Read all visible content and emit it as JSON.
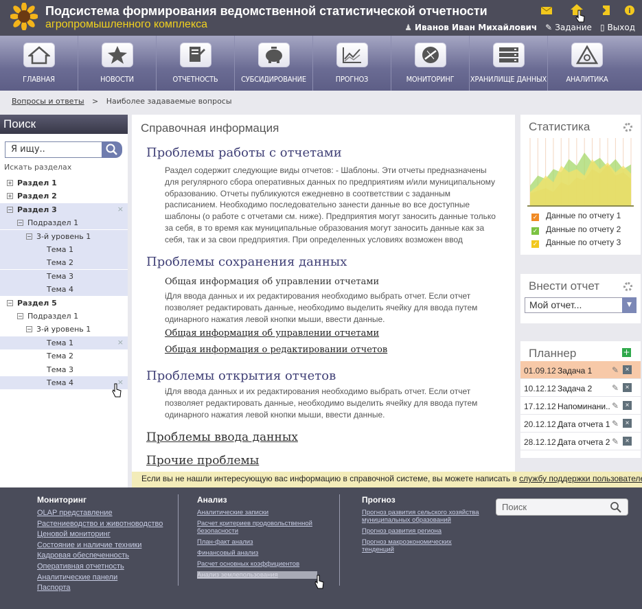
{
  "header": {
    "title": "Подсистема формирования ведомственной статистической отчетности",
    "subtitle": "агропромышленного комплекса",
    "user": "Иванов Иван Михайлович",
    "task_label": "Задание",
    "exit_label": "Выход"
  },
  "nav": [
    {
      "label": "ГЛАВНАЯ",
      "icon": "home-icon"
    },
    {
      "label": "НОВОСТИ",
      "icon": "star-icon"
    },
    {
      "label": "ОТЧЕТНОСТЬ",
      "icon": "report-icon"
    },
    {
      "label": "СУБСИДИРОВАНИЕ",
      "icon": "piggybank-icon"
    },
    {
      "label": "ПРОГНОЗ",
      "icon": "forecast-chart-icon"
    },
    {
      "label": "МОНИТОРИНГ",
      "icon": "monitoring-icon"
    },
    {
      "label": "ХРАНИЛИЩЕ ДАННЫХ",
      "icon": "server-icon"
    },
    {
      "label": "АНАЛИТИКА",
      "icon": "analytics-icon"
    }
  ],
  "breadcrumb": {
    "link": "Вопросы и ответы",
    "sep": ">",
    "current": "Наиболее задаваемые вопросы"
  },
  "search": {
    "title": "Поиск",
    "placeholder": "Я ищу..",
    "sections_label": "Искать разделах"
  },
  "tree": [
    {
      "label": "Раздел 1",
      "level": 0,
      "bold": true,
      "expander": "+"
    },
    {
      "label": "Раздел 2",
      "level": 0,
      "bold": true,
      "expander": "+"
    },
    {
      "label": "Раздел 3",
      "level": 0,
      "bold": true,
      "expander": "−",
      "selected": true,
      "close": true
    },
    {
      "label": "Подраздел 1",
      "level": 1,
      "expander": "−",
      "selected": true
    },
    {
      "label": "3-й уровень 1",
      "level": 2,
      "expander": "−",
      "selected": true
    },
    {
      "label": "Тема 1",
      "level": 3,
      "selected": true
    },
    {
      "label": "Тема 2",
      "level": 3,
      "selected": true
    },
    {
      "label": "Тема 3",
      "level": 3,
      "selected": true
    },
    {
      "label": "Тема 4",
      "level": 3,
      "selected": true
    },
    {
      "label": "Раздел 5",
      "level": 0,
      "bold": true,
      "expander": "−"
    },
    {
      "label": "Подраздел 1",
      "level": 1,
      "expander": "−"
    },
    {
      "label": "3-й уровень 1",
      "level": 2,
      "expander": "−"
    },
    {
      "label": "Тема 1",
      "level": 3,
      "selected": true,
      "close": true
    },
    {
      "label": "Тема 2",
      "level": 3
    },
    {
      "label": "Тема 3",
      "level": 3
    },
    {
      "label": "Тема 4",
      "level": 3,
      "selected": true,
      "close": true
    }
  ],
  "main": {
    "title": "Справочная информация",
    "s1": {
      "heading": "Проблемы работы с отчетами",
      "text": "Раздел содержит следующие виды отчетов: - Шаблоны. Эти отчеты предназначены для регулярного сбора оперативных данных по предприятиям и/или муниципальному образованию. Отчеты публикуются ежедневно в соответствии с заданным расписанием. Необходимо последовательно занести данные во все доступные шаблоны (о работе с отчетами см. ниже). Предприятия могут заносить данные только за себя, в то время как муниципальные образования могут заносить данные как за себя, так и за свои предприятия. При определенных условиях возможен ввод"
    },
    "s2": {
      "heading": "Проблемы сохранения данных",
      "subheading": "Общая информация об управлении отчетами",
      "text": "iДля ввода данных и их редактирования необходимо выбрать отчет. Если отчет позволяет редактировать данные, необходимо выделить ячейку для ввода путем одинарного нажатия левой кнопки мыши, ввести данные.",
      "link1": "Общая информация об управлении отчетами",
      "link2": "Общая информация о редактировании отчетов"
    },
    "s3": {
      "heading": "Проблемы открытия отчетов",
      "text": "iДля ввода данных и их редактирования необходимо выбрать отчет. Если отчет позволяет редактировать данные, необходимо выделить ячейку для ввода путем одинарного нажатия левой кнопки мыши, ввести данные."
    },
    "link4": "Проблемы ввода данных",
    "link5": "Прочие проблемы"
  },
  "helpbar": {
    "text": "Если вы не нашли интересующую вас информацию в справочной системе, вы можете написать в ",
    "link": "службу поддержки пользователей"
  },
  "stats": {
    "title": "Статистика",
    "legend": [
      {
        "label": "Данные по отчету 1",
        "color": "#f08a24",
        "mark": "✓"
      },
      {
        "label": "Данные по отчету 2",
        "color": "#7cc242",
        "mark": "✓"
      },
      {
        "label": "Данные по отчету 3",
        "color": "#f2c81e",
        "mark": "✓"
      }
    ]
  },
  "chart_data": {
    "type": "area",
    "title": "",
    "series": [
      {
        "name": "Данные по отчету 1",
        "color": "#f6a35c",
        "values": [
          18,
          22,
          26,
          20,
          35,
          30,
          42,
          38,
          55,
          48,
          62,
          45,
          50,
          40
        ]
      },
      {
        "name": "Данные по отчету 2",
        "color": "#a6d86a",
        "values": [
          30,
          45,
          40,
          55,
          50,
          70,
          60,
          80,
          65,
          72,
          58,
          70,
          55,
          62
        ]
      },
      {
        "name": "Данные по отчету 3",
        "color": "#f4e26a",
        "values": [
          20,
          30,
          45,
          35,
          60,
          50,
          55,
          45,
          70,
          55,
          65,
          50,
          60,
          48
        ]
      }
    ],
    "ylim": [
      0,
      100
    ]
  },
  "report": {
    "title": "Внести отчет",
    "value": "Мой отчет..."
  },
  "planner": {
    "title": "Планнер",
    "rows": [
      {
        "date": "01.09.12",
        "task": "Задача 1",
        "highlight": true
      },
      {
        "date": "10.12.12",
        "task": "Задача 2"
      },
      {
        "date": "17.12.12",
        "task": "Напоминани..."
      },
      {
        "date": "20.12.12",
        "task": "Дата отчета 1"
      },
      {
        "date": "28.12.12",
        "task": "Дата отчета 2"
      }
    ]
  },
  "footer": {
    "col1": {
      "title": "Мониторинг",
      "links": [
        "OLAP представление",
        "Растениеводство и животноводство",
        "Ценовой мониторинг",
        "Состояние и наличие техники",
        "Кадровая обеспеченность",
        "Оперативная отчетность",
        "Аналитические панели",
        "Паспорта"
      ]
    },
    "col2": {
      "title": "Анализ",
      "links": [
        "Аналитические записки",
        "Расчет критериев продовольственной безопасности",
        "План-факт анализ",
        "Финансовый анализ",
        "Расчет основных коэффициентов",
        "Анализ землепользования"
      ]
    },
    "col3": {
      "title": "Прогноз",
      "links": [
        "Прогноз развития сельского хозяйства муниципальных образований",
        "Прогноз развития региона",
        "Прогноз макроэкономических тенденций"
      ]
    },
    "search_placeholder": "Поиск"
  }
}
